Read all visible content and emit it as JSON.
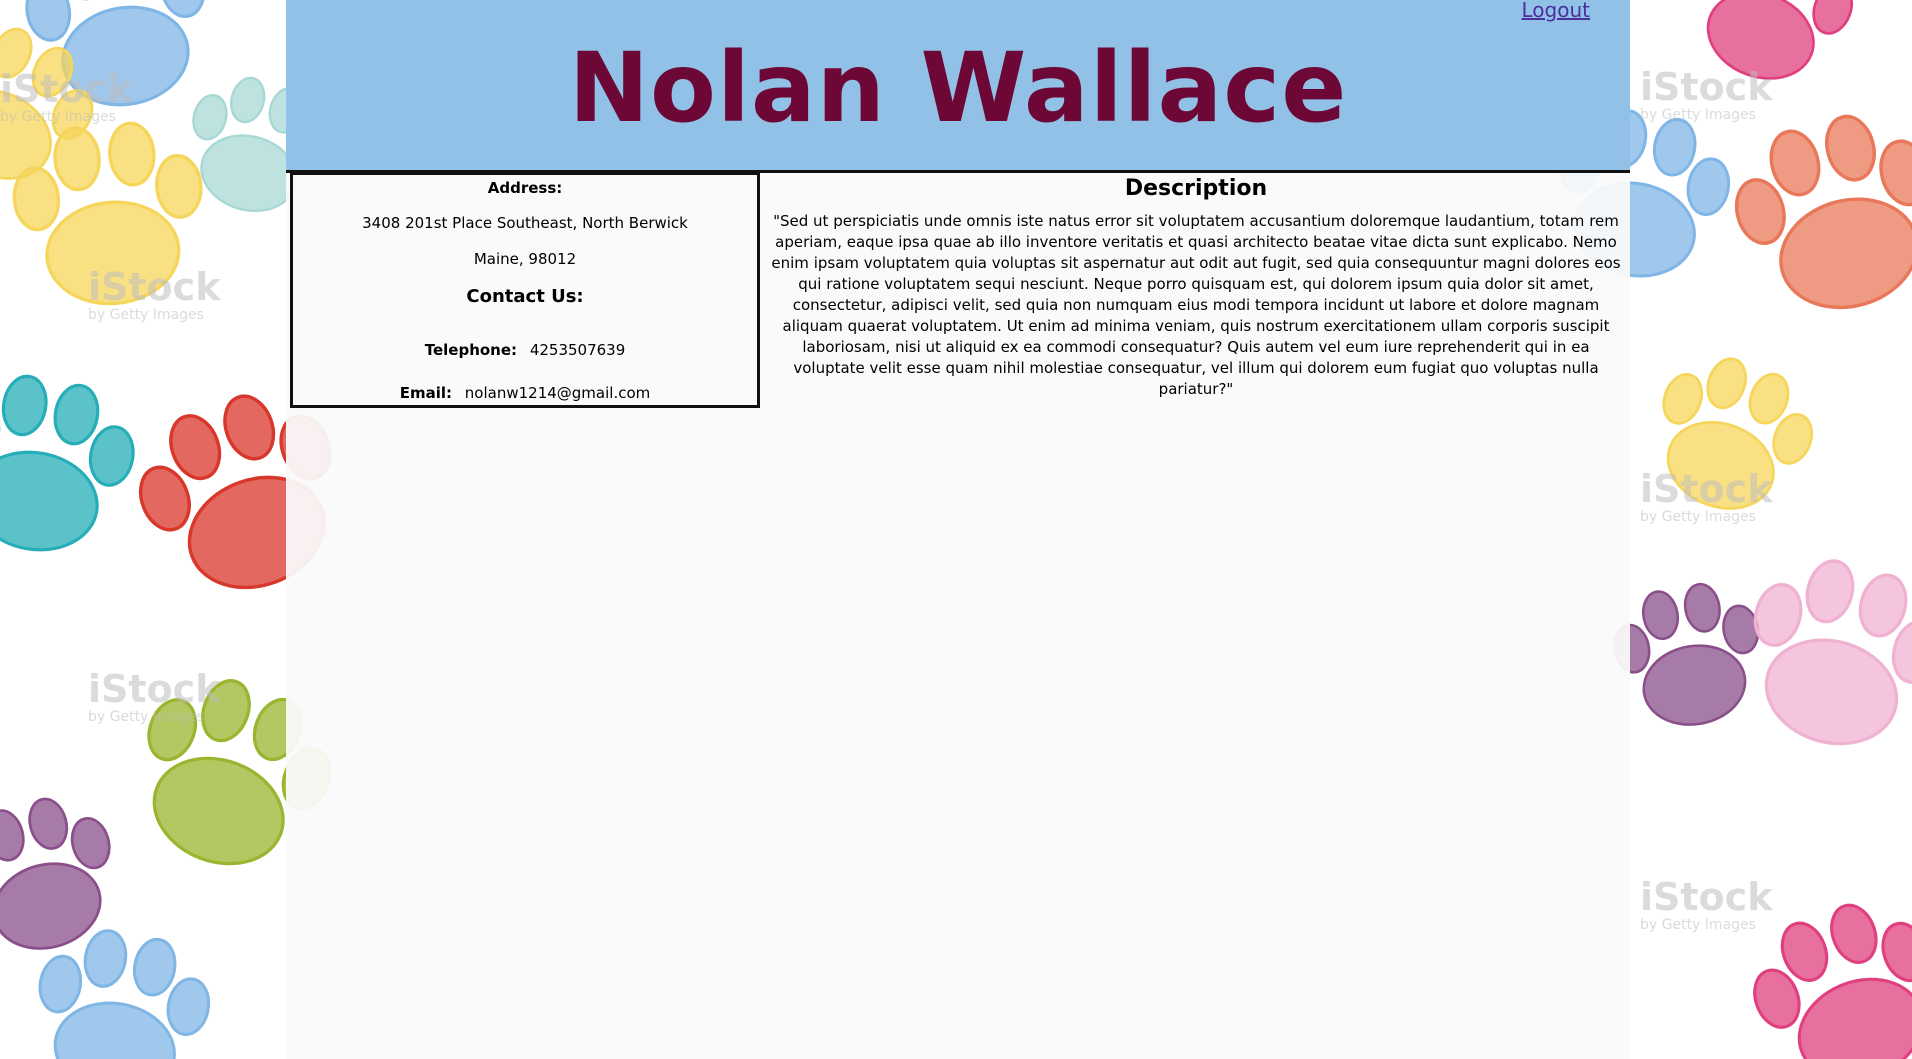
{
  "header": {
    "name": "Nolan Wallace",
    "logout_label": "Logout"
  },
  "info": {
    "address_title": "Address:",
    "address_line1": "3408 201st Place Southeast, North Berwick",
    "address_line2": "Maine, 98012",
    "contact_title": "Contact Us:",
    "telephone_label": "Telephone:",
    "telephone_value": "4253507639",
    "email_label": "Email:",
    "email_value": "nolanw1214@gmail.com"
  },
  "description": {
    "title": "Description",
    "text": "\"Sed ut perspiciatis unde omnis iste natus error sit voluptatem accusantium doloremque laudantium, totam rem aperiam, eaque ipsa quae ab illo inventore veritatis et quasi architecto beatae vitae dicta sunt explicabo. Nemo enim ipsam voluptatem quia voluptas sit aspernatur aut odit aut fugit, sed quia consequuntur magni dolores eos qui ratione voluptatem sequi nesciunt. Neque porro quisquam est, qui dolorem ipsum quia dolor sit amet, consectetur, adipisci velit, sed quia non numquam eius modi tempora incidunt ut labore et dolore magnam aliquam quaerat voluptatem. Ut enim ad minima veniam, quis nostrum exercitationem ullam corporis suscipit laboriosam, nisi ut aliquid ex ea commodi consequatur? Quis autem vel eum iure reprehenderit qui in ea voluptate velit esse quam nihil molestiae consequatur, vel illum qui dolorem eum fugiat quo voluptas nulla pariatur?\""
  },
  "background": {
    "watermark_text": "iStock",
    "watermark_subtext": "by Getty Images",
    "paw_colors": [
      "#7fb6e6",
      "#f5d65a",
      "#25adb8",
      "#d9372b",
      "#9ab52f",
      "#8a4f8a",
      "#e0407f",
      "#e9785a",
      "#f0b2d2",
      "#a8d8d4"
    ]
  },
  "colors": {
    "header_bg": "#92c1e7",
    "name_color": "#6d0735",
    "link_color": "#4b2f9a"
  }
}
